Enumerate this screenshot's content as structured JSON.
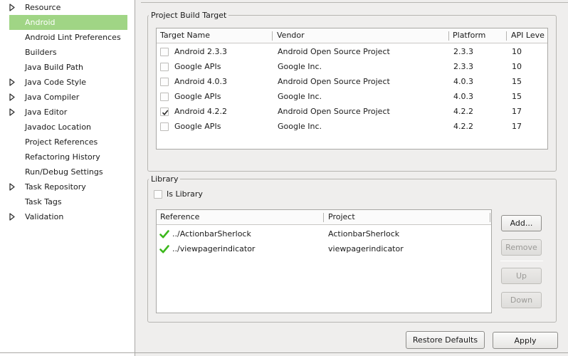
{
  "sidebar": {
    "items": [
      {
        "label": "Resource",
        "expandable": true,
        "selected": false
      },
      {
        "label": "Android",
        "expandable": false,
        "selected": true
      },
      {
        "label": "Android Lint Preferences",
        "expandable": false,
        "selected": false
      },
      {
        "label": "Builders",
        "expandable": false,
        "selected": false
      },
      {
        "label": "Java Build Path",
        "expandable": false,
        "selected": false
      },
      {
        "label": "Java Code Style",
        "expandable": true,
        "selected": false
      },
      {
        "label": "Java Compiler",
        "expandable": true,
        "selected": false
      },
      {
        "label": "Java Editor",
        "expandable": true,
        "selected": false
      },
      {
        "label": "Javadoc Location",
        "expandable": false,
        "selected": false
      },
      {
        "label": "Project References",
        "expandable": false,
        "selected": false
      },
      {
        "label": "Refactoring History",
        "expandable": false,
        "selected": false
      },
      {
        "label": "Run/Debug Settings",
        "expandable": false,
        "selected": false
      },
      {
        "label": "Task Repository",
        "expandable": true,
        "selected": false
      },
      {
        "label": "Task Tags",
        "expandable": false,
        "selected": false
      },
      {
        "label": "Validation",
        "expandable": true,
        "selected": false
      }
    ]
  },
  "build_target": {
    "title": "Project Build Target",
    "columns": [
      "Target Name",
      "Vendor",
      "Platform",
      "API Leve"
    ],
    "rows": [
      {
        "checked": false,
        "name": "Android 2.3.3",
        "vendor": "Android Open Source Project",
        "platform": "2.3.3",
        "api": "10"
      },
      {
        "checked": false,
        "name": "Google APIs",
        "vendor": "Google Inc.",
        "platform": "2.3.3",
        "api": "10"
      },
      {
        "checked": false,
        "name": "Android 4.0.3",
        "vendor": "Android Open Source Project",
        "platform": "4.0.3",
        "api": "15"
      },
      {
        "checked": false,
        "name": "Google APIs",
        "vendor": "Google Inc.",
        "platform": "4.0.3",
        "api": "15"
      },
      {
        "checked": true,
        "name": "Android 4.2.2",
        "vendor": "Android Open Source Project",
        "platform": "4.2.2",
        "api": "17"
      },
      {
        "checked": false,
        "name": "Google APIs",
        "vendor": "Google Inc.",
        "platform": "4.2.2",
        "api": "17"
      }
    ]
  },
  "library": {
    "title": "Library",
    "is_library_label": "Is Library",
    "is_library_checked": false,
    "columns": [
      "Reference",
      "Project"
    ],
    "rows": [
      {
        "status": "ok",
        "reference": "../ActionbarSherlock",
        "project": "ActionbarSherlock"
      },
      {
        "status": "ok",
        "reference": "../viewpagerindicator",
        "project": "viewpagerindicator"
      }
    ],
    "buttons": {
      "add": "Add...",
      "remove": "Remove",
      "up": "Up",
      "down": "Down"
    }
  },
  "footer": {
    "restore_defaults": "Restore Defaults",
    "apply": "Apply"
  },
  "colors": {
    "selection": "#a0d585",
    "check_ok": "#3cb81c",
    "window_bg": "#efeeed"
  },
  "icons": {
    "expander": "triangle-right-icon",
    "checkmark": "checkmark-icon",
    "status_ok": "green-checkmark-icon"
  }
}
